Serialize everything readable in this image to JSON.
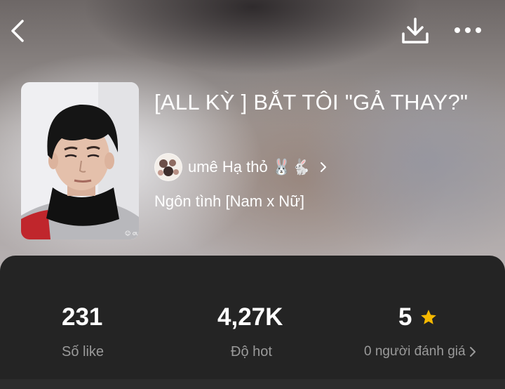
{
  "header": {
    "back_icon": "chevron-left-icon",
    "download_icon": "download-icon",
    "more_icon": "more-horizontal-icon"
  },
  "book": {
    "title": "[ALL KỲ ] BẮT TÔI \"GẢ THAY?\"",
    "author": "umê Hạ thỏ 🐰🐇",
    "genre": "Ngôn tình [Nam x Nữ]"
  },
  "stats": {
    "likes_value": "231",
    "likes_label": "Số like",
    "hot_value": "4,27K",
    "hot_label": "Độ hot",
    "rating_value": "5",
    "rating_label": "0 người đánh giá",
    "star_color": "#F5B800"
  }
}
